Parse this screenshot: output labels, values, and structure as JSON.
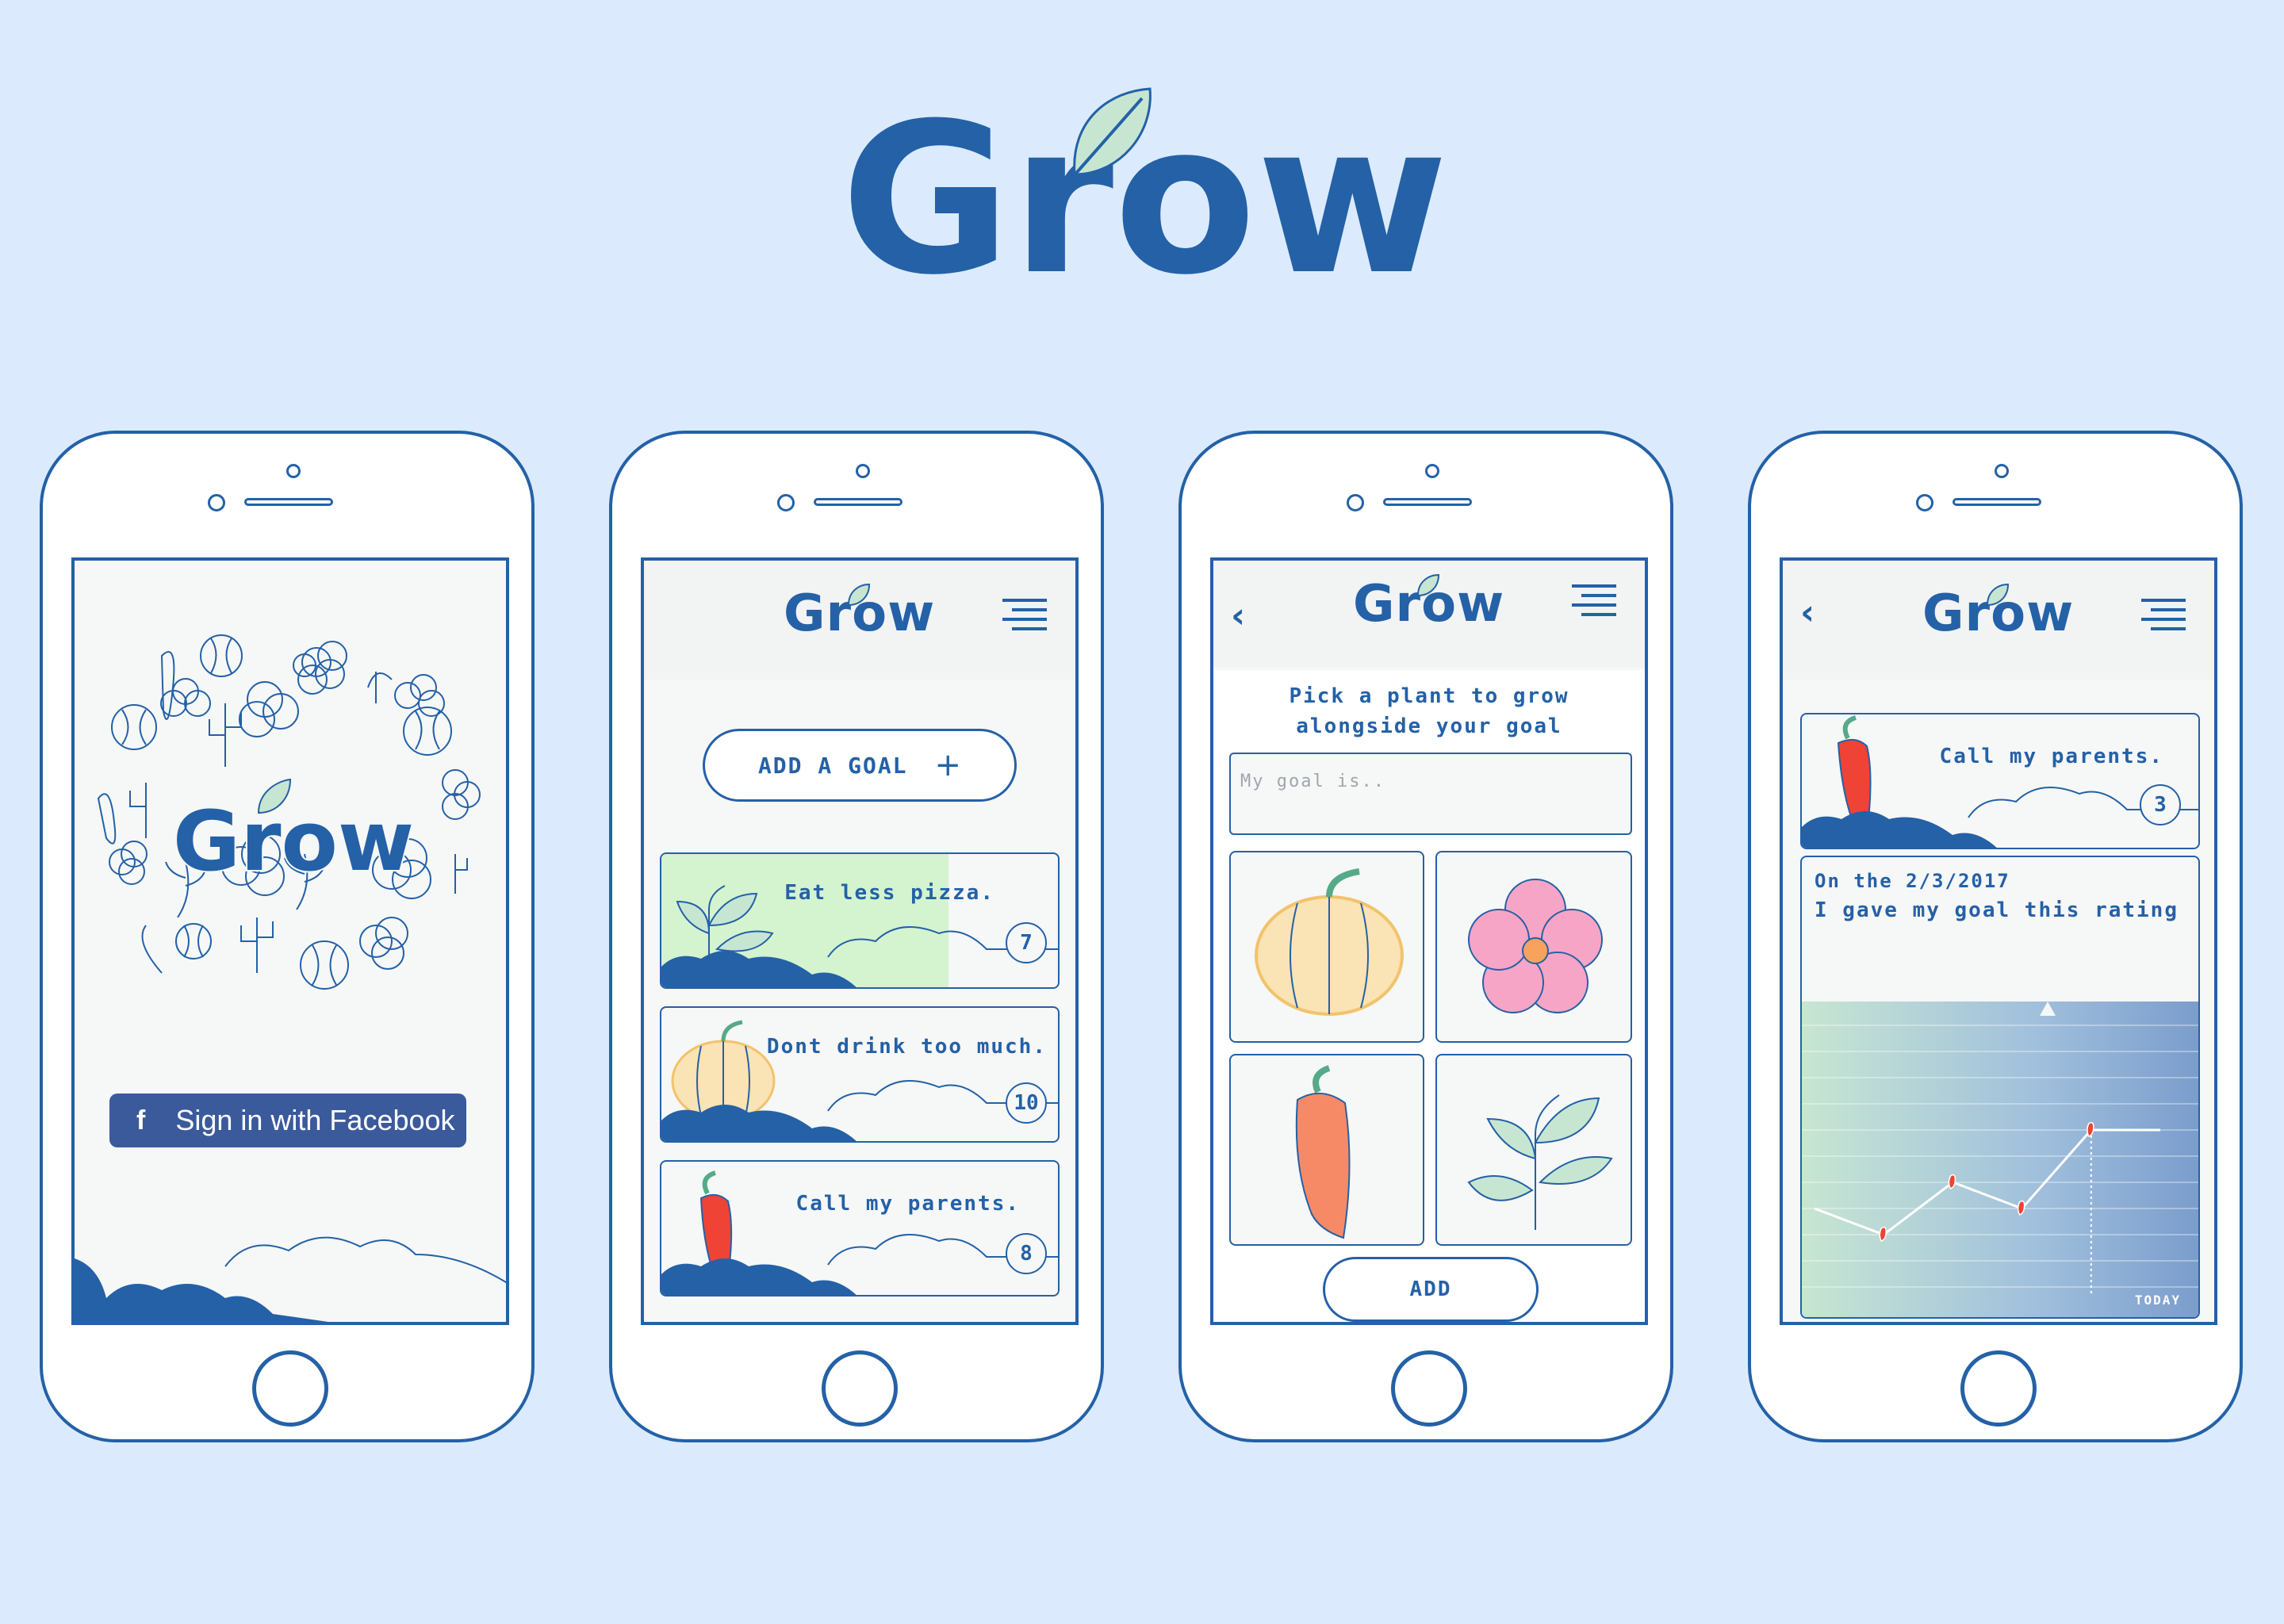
{
  "brand": {
    "title": "Grow",
    "accent": "#2461a7",
    "leaf_color": "#c7e6d2"
  },
  "phone1": {
    "logo": "Grow",
    "fb_icon": "f",
    "fb_label": "Sign in with Facebook"
  },
  "phone2": {
    "logo": "Grow",
    "add_goal": "ADD A GOAL",
    "add_icon": "+",
    "goals": [
      {
        "title": "Eat less pizza.",
        "count": "7",
        "plant": "sprout-icon"
      },
      {
        "title": "Dont drink too much.",
        "count": "10",
        "plant": "pumpkin-icon"
      },
      {
        "title": "Call my parents.",
        "count": "8",
        "plant": "chili-icon"
      }
    ]
  },
  "phone3": {
    "logo": "Grow",
    "back": "‹",
    "prompt": "Pick a plant to grow alongside your goal",
    "goal_placeholder": "My goal is..",
    "plants": [
      "pumpkin-icon",
      "flower-icon",
      "chili-icon",
      "sprout-icon"
    ],
    "add_label": "ADD"
  },
  "phone4": {
    "logo": "Grow",
    "back": "‹",
    "goal_title": "Call my parents.",
    "goal_count": "3",
    "rating_date_line": "On the 2/3/2017",
    "rating_line": "I gave my goal this rating",
    "today_label": "TODAY"
  },
  "chart_data": {
    "type": "line",
    "x": [
      1,
      2,
      3,
      4,
      5,
      6
    ],
    "values": [
      3,
      2,
      4,
      3,
      6,
      6
    ],
    "ylim": [
      0,
      10
    ],
    "xlabel": "",
    "ylabel": "",
    "title": ""
  }
}
